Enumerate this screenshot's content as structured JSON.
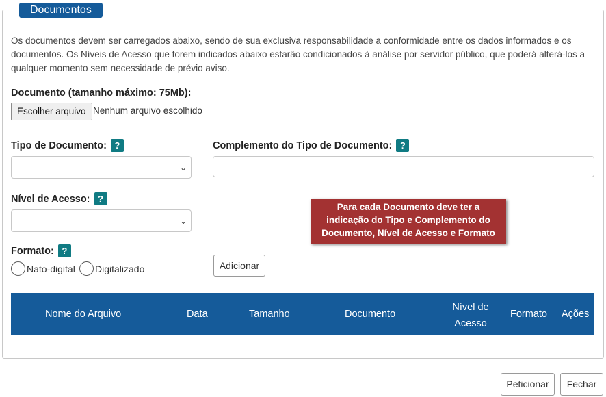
{
  "section": {
    "legend": "Documentos",
    "intro": "Os documentos devem ser carregados abaixo, sendo de sua exclusiva responsabilidade a conformidade entre os dados informados e os documentos. Os Níveis de Acesso que forem indicados abaixo estarão condicionados à análise por servidor público, que poderá alterá-los a qualquer momento sem necessidade de prévio aviso."
  },
  "upload": {
    "label": "Documento (tamanho máximo: 75Mb):",
    "button": "Escolher arquivo",
    "status": "Nenhum arquivo escolhido"
  },
  "fields": {
    "tipo_label": "Tipo de Documento:",
    "complemento_label": "Complemento do Tipo de Documento:",
    "nivel_label": "Nível de Acesso:",
    "formato_label": "Formato:",
    "help_glyph": "?"
  },
  "formato_options": [
    "Nato-digital",
    "Digitalizado"
  ],
  "add_button": "Adicionar",
  "callout": {
    "lines": [
      "Para cada Documento deve ter a",
      "indicação do Tipo e Complemento do",
      "Documento, Nível de Acesso e Formato"
    ]
  },
  "table": {
    "headers": [
      "Nome do Arquivo",
      "Data",
      "Tamanho",
      "Documento",
      "Nível de",
      "Acesso",
      "Formato",
      "Ações"
    ]
  },
  "footer": {
    "peticionar": "Peticionar",
    "fechar": "Fechar"
  },
  "icons": {
    "select_chevron": "chevron-down-icon",
    "help": "help-icon"
  },
  "colors": {
    "primary": "#155b9a",
    "help": "#107b83",
    "callout": "#a33232"
  }
}
